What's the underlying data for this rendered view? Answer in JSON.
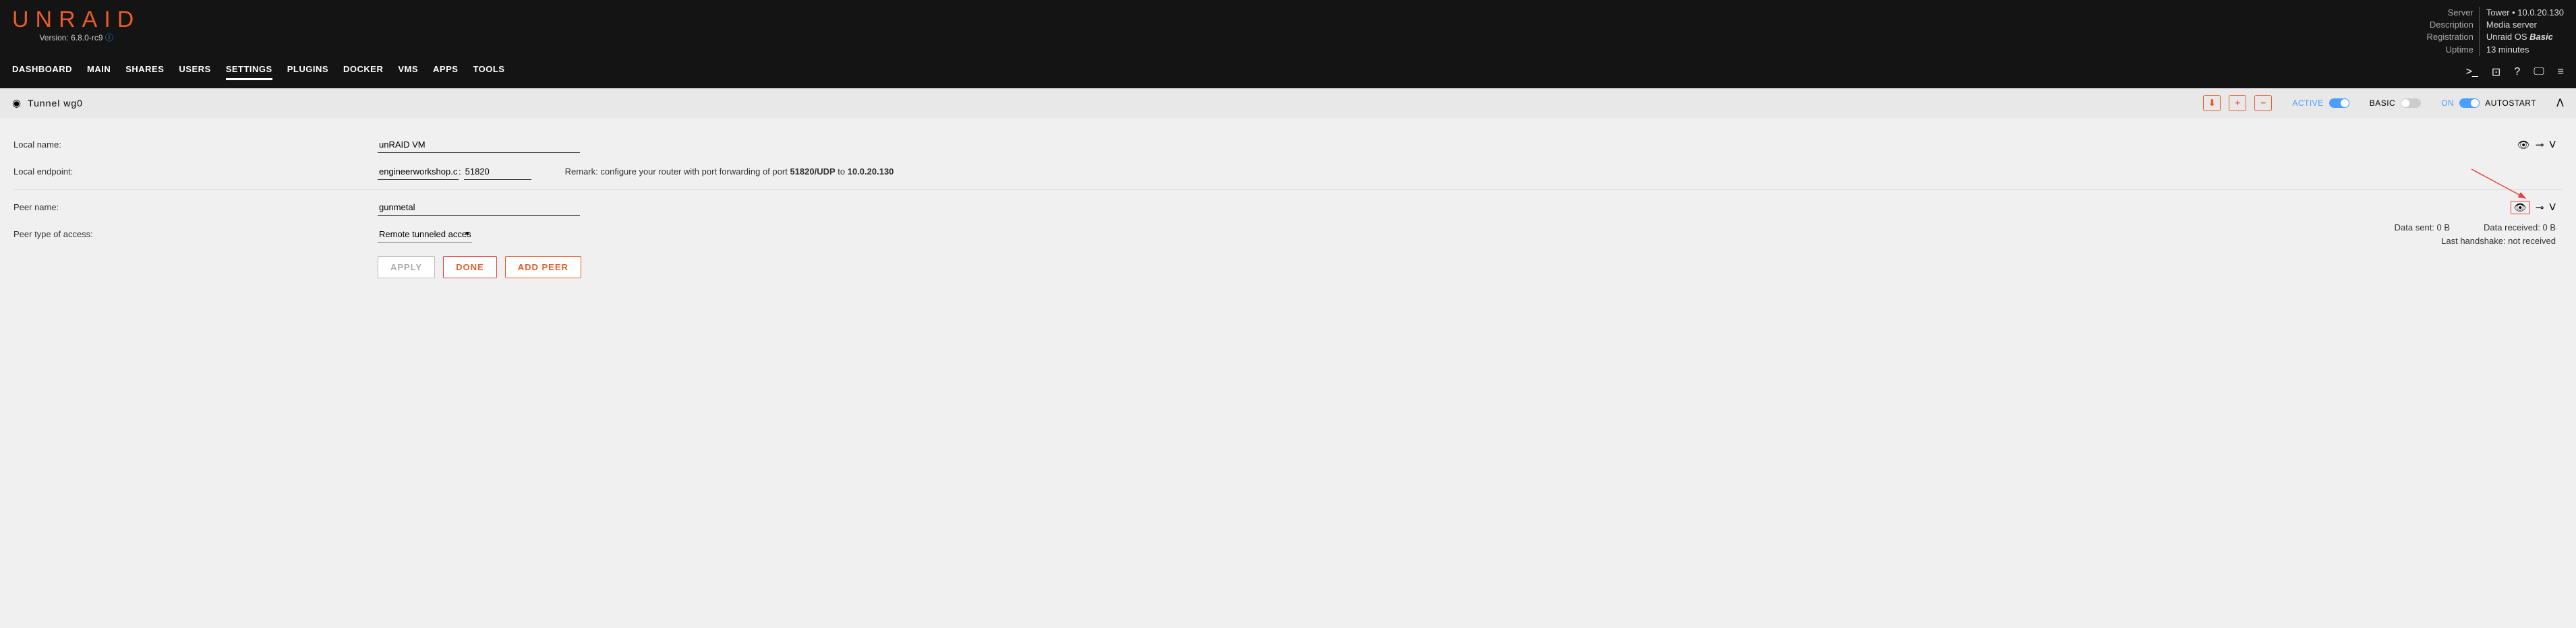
{
  "logo": "UNRAID",
  "version_text": "Version: 6.8.0-rc9",
  "server_info": {
    "labels": {
      "server": "Server",
      "desc": "Description",
      "reg": "Registration",
      "uptime": "Uptime"
    },
    "values": {
      "server": "Tower • 10.0.20.130",
      "desc": "Media server",
      "reg_prefix": "Unraid OS ",
      "reg_bold": "Basic",
      "uptime": "13 minutes"
    }
  },
  "nav": [
    "DASHBOARD",
    "MAIN",
    "SHARES",
    "USERS",
    "SETTINGS",
    "PLUGINS",
    "DOCKER",
    "VMS",
    "APPS",
    "TOOLS"
  ],
  "panel": {
    "title": "Tunnel wg0",
    "toggles": {
      "active": "ACTIVE",
      "basic": "BASIC",
      "autostart": "AUTOSTART",
      "on": "ON"
    }
  },
  "form": {
    "local_name_label": "Local name:",
    "local_name_value": "unRAID VM",
    "local_endpoint_label": "Local endpoint:",
    "local_endpoint_host": "engineerworkshop.com",
    "local_endpoint_colon": ":",
    "local_endpoint_port": "51820",
    "remark_prefix": "Remark: configure your router with port forwarding of port ",
    "remark_port": "51820/UDP",
    "remark_mid": " to ",
    "remark_ip": "10.0.20.130",
    "peer_name_label": "Peer name:",
    "peer_name_value": "gunmetal",
    "peer_type_label": "Peer type of access:",
    "peer_type_value": "Remote tunneled access",
    "data_sent_label": "Data sent: ",
    "data_sent_value": "0 B",
    "data_recv_label": "Data received: ",
    "data_recv_value": "0 B",
    "handshake_label": "Last handshake: ",
    "handshake_value": "not received"
  },
  "buttons": {
    "apply": "APPLY",
    "done": "DONE",
    "addpeer": "ADD PEER"
  }
}
